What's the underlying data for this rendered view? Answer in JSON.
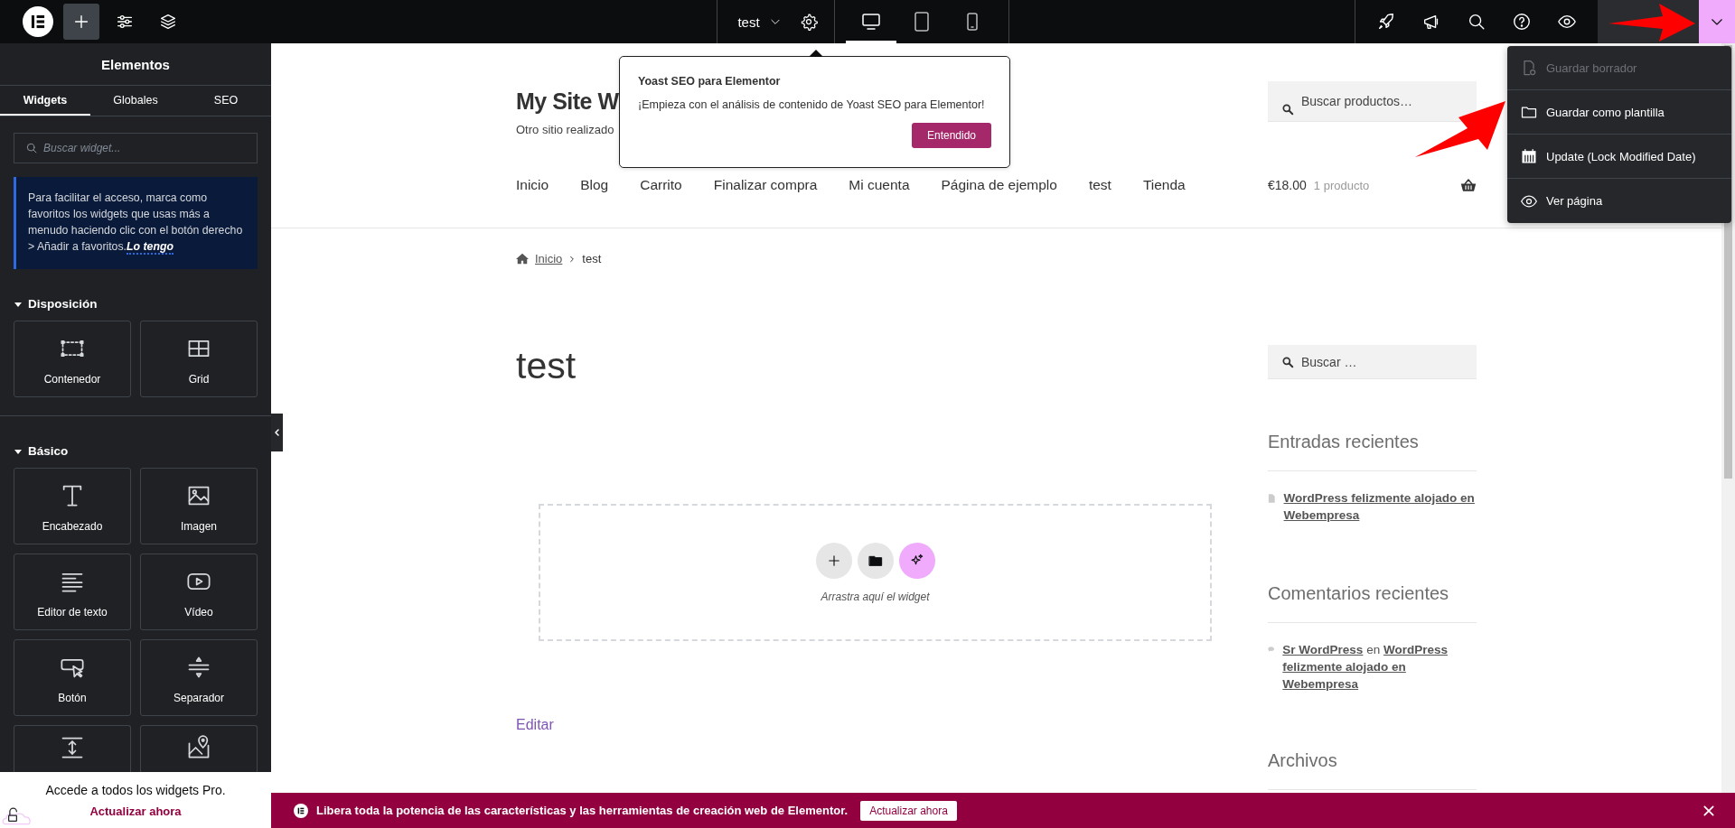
{
  "topbar": {
    "left_tools": [
      {
        "kind": "logo",
        "selected": false
      },
      {
        "kind": "add",
        "selected": true
      },
      {
        "kind": "settings",
        "selected": false
      },
      {
        "kind": "layers",
        "selected": false
      }
    ],
    "page_title": "test",
    "devices": [
      {
        "kind": "desktop",
        "selected": true
      },
      {
        "kind": "tablet",
        "selected": false
      },
      {
        "kind": "mobile",
        "selected": false
      }
    ],
    "right_tools": [
      {
        "kind": "rocket"
      },
      {
        "kind": "megaphone"
      },
      {
        "kind": "search"
      },
      {
        "kind": "help"
      },
      {
        "kind": "eye"
      }
    ],
    "publish_menu": {
      "expanded": true
    }
  },
  "publish_dropdown": {
    "items": [
      {
        "label": "Guardar borrador",
        "kind": "draft",
        "disabled": true
      },
      {
        "label": "Guardar como plantilla",
        "kind": "folder",
        "disabled": false
      },
      {
        "label": "Update (Lock Modified Date)",
        "kind": "calendar",
        "disabled": false
      },
      {
        "label": "Ver página",
        "kind": "eye",
        "disabled": false
      }
    ]
  },
  "sidebar": {
    "title": "Elementos",
    "tabs": [
      {
        "label": "Widgets",
        "selected": true
      },
      {
        "label": "Globales",
        "selected": false
      },
      {
        "label": "SEO",
        "selected": false
      }
    ],
    "search": {
      "placeholder": "Buscar widget..."
    },
    "notice": {
      "text": "Para facilitar el acceso, marca como favoritos los widgets que usas más a menudo haciendo clic con el botón derecho > Añadir a favoritos.",
      "link": "Lo tengo"
    },
    "sections": [
      {
        "title": "Disposición",
        "expanded": true,
        "widgets": [
          {
            "label": "Contenedor",
            "kind": "container"
          },
          {
            "label": "Grid",
            "kind": "grid"
          }
        ]
      },
      {
        "title": "Básico",
        "expanded": true,
        "widgets": [
          {
            "label": "Encabezado",
            "kind": "heading"
          },
          {
            "label": "Imagen",
            "kind": "image"
          },
          {
            "label": "Editor de texto",
            "kind": "text"
          },
          {
            "label": "Vídeo",
            "kind": "video"
          },
          {
            "label": "Botón",
            "kind": "button"
          },
          {
            "label": "Separador",
            "kind": "separator"
          },
          {
            "kind": "spacer"
          },
          {
            "kind": "map"
          }
        ]
      }
    ],
    "promo": {
      "text": "Accede a todos los widgets Pro.",
      "link": "Actualizar ahora"
    }
  },
  "popover": {
    "title": "Yoast SEO para Elementor",
    "text": "¡Empieza con el análisis de contenido de Yoast SEO para Elementor!",
    "button": "Entendido"
  },
  "site": {
    "title": "My Site W",
    "tagline": "Otro sitio realizado",
    "product_search": {
      "placeholder": "Buscar productos…"
    },
    "nav": [
      "Inicio",
      "Blog",
      "Carrito",
      "Finalizar compra",
      "Mi cuenta",
      "Página de ejemplo",
      "test",
      "Tienda"
    ],
    "cart": {
      "amount": "€18.00",
      "count": "1 producto"
    },
    "breadcrumb": {
      "home": "Inicio",
      "current": "test"
    },
    "page_title": "test",
    "dropzone": {
      "hint": "Arrastra aquí el widget"
    },
    "edit_link": "Editar",
    "sidebar_search": {
      "placeholder": "Buscar …"
    },
    "widgets": [
      {
        "title": "Entradas recientes",
        "kind": "posts",
        "items": [
          {
            "post": "WordPress felizmente alojado en Webempresa"
          }
        ]
      },
      {
        "title": "Comentarios recientes",
        "kind": "comments",
        "items": [
          {
            "author": "Sr WordPress",
            "connector": "en",
            "post": "WordPress felizmente alojado en Webempresa"
          }
        ]
      },
      {
        "title": "Archivos",
        "kind": "archives"
      }
    ]
  },
  "banner": {
    "text": "Libera toda la potencia de las características y las herramientas de creación web de Elementor.",
    "button": "Actualizar ahora"
  }
}
